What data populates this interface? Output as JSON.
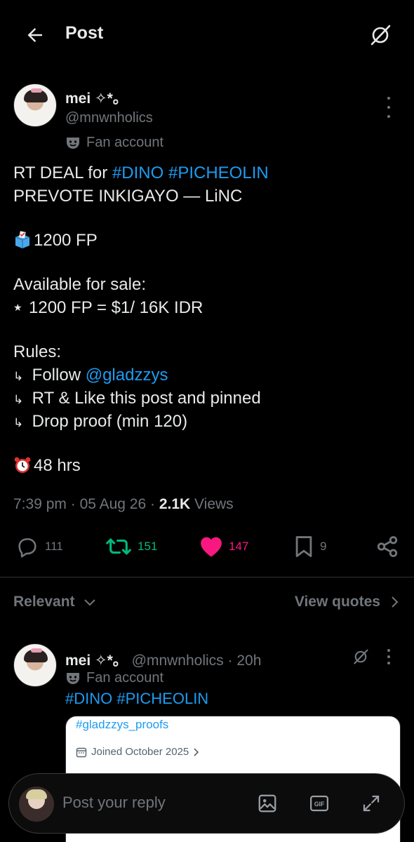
{
  "header": {
    "title": "Post"
  },
  "post": {
    "display_name": "mei ✧*。",
    "handle": "@mnwnholics",
    "badge": "Fan account",
    "lines": {
      "l1_prefix": "RT DEAL for ",
      "l1_tag1": "#DINO",
      "l1_tag2": "#PICHEOLIN",
      "l2": "PREVOTE INKIGAYO — LiNC",
      "l3": "1200 FP",
      "l4": "Available for sale:",
      "l5": "1200 FP = $1/ 16K IDR",
      "l6": "Rules:",
      "l7_prefix": "Follow ",
      "l7_mention": "@gladzzys",
      "l8": "RT & Like this post and pinned",
      "l9": "Drop proof (min 120)",
      "l10": "48 hrs"
    },
    "meta": {
      "time": "7:39 pm",
      "date": "05 Aug 26",
      "views_count": "2.1K",
      "views_label": "Views"
    },
    "actions": {
      "replies": "111",
      "reposts": "151",
      "likes": "147",
      "bookmarks": "9"
    }
  },
  "sort": {
    "label": "Relevant",
    "view_quotes": "View quotes"
  },
  "reply": {
    "display_name": "mei ✧*。",
    "handle": "@mnwnholics",
    "time": "20h",
    "badge": "Fan account",
    "tag1": "#DINO",
    "tag2": "#PICHEOLIN",
    "media": {
      "tag": "#gladzzys_proofs",
      "joined": "Joined October 2025"
    }
  },
  "composer": {
    "placeholder": "Post your reply",
    "gif_label": "GIF"
  },
  "colors": {
    "accent": "#1d9bf0",
    "repost": "#00ba7c",
    "like": "#f91880",
    "muted": "#71767b"
  }
}
